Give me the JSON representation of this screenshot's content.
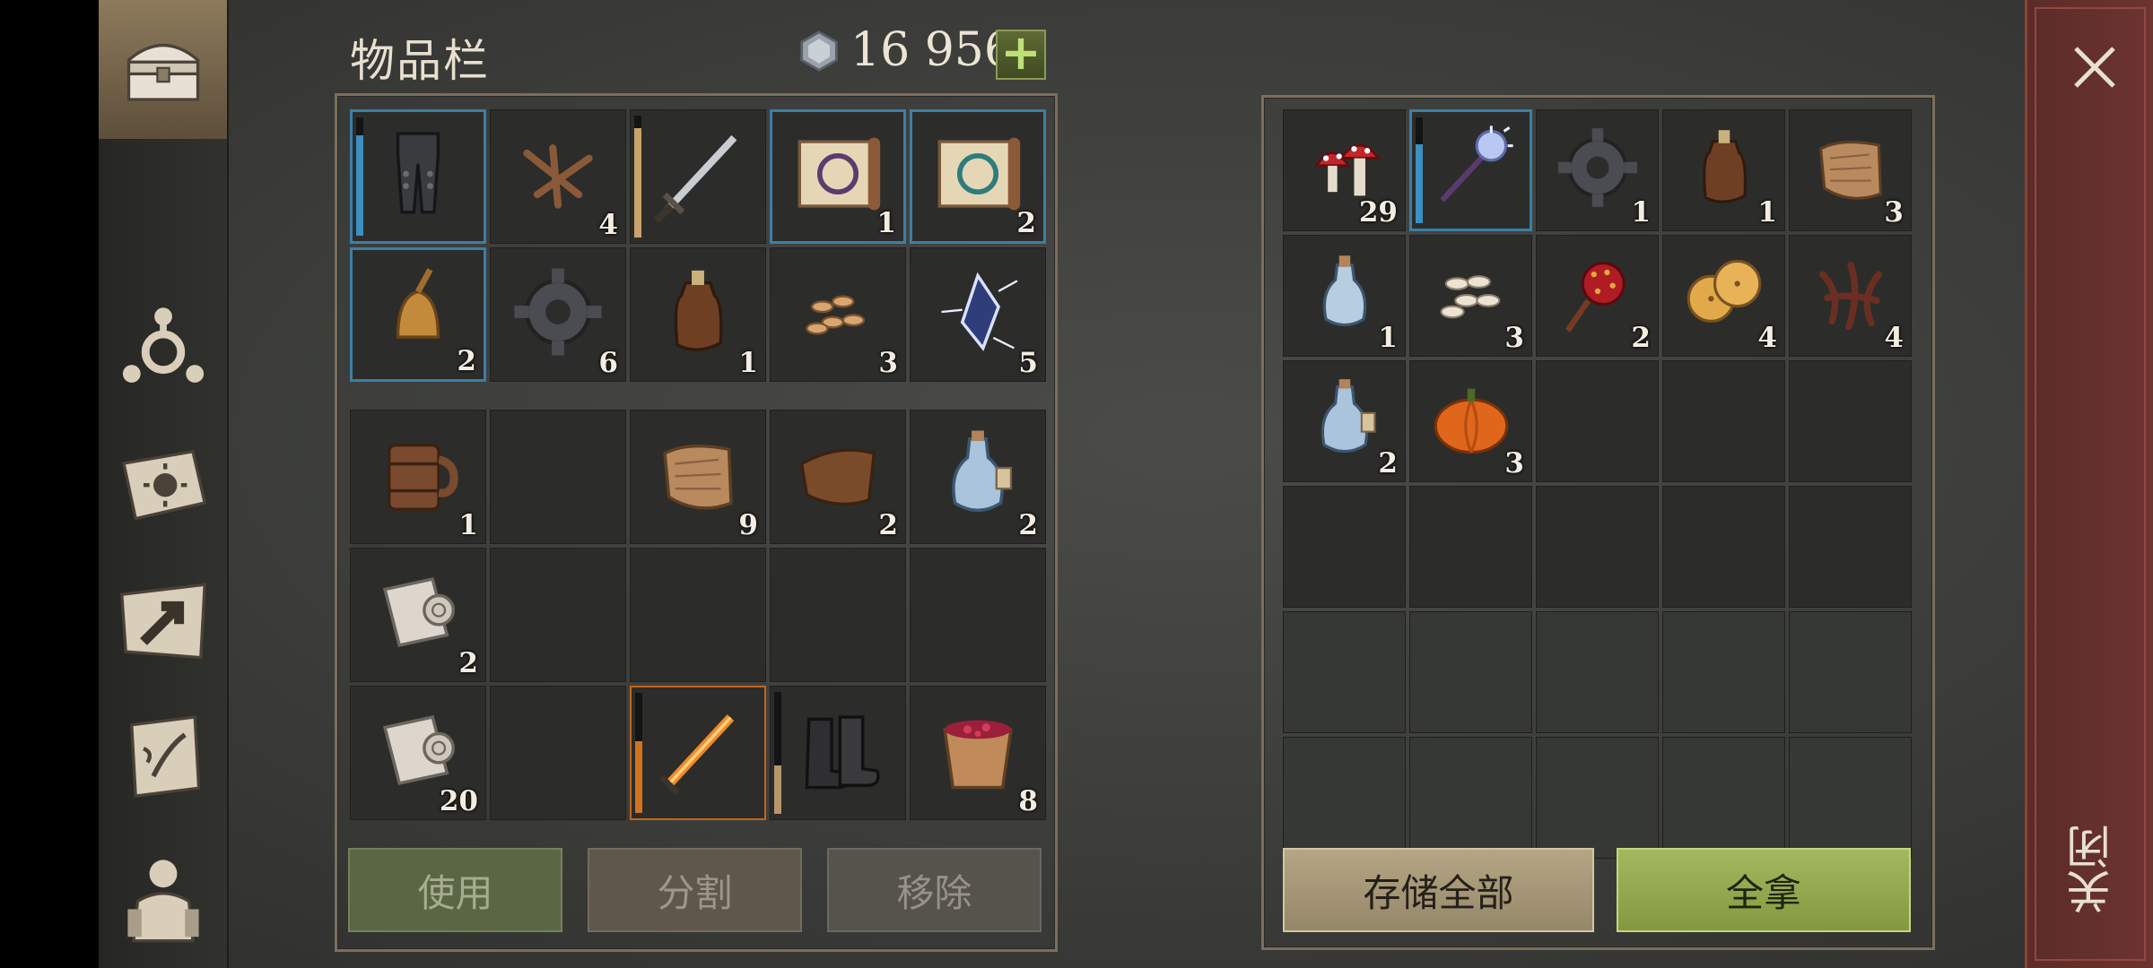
{
  "header": {
    "title": "物品栏",
    "currency_value": "16 956",
    "add_label": "+"
  },
  "colors": {
    "accent_green": "#a4b85f",
    "close_red": "#6d3430",
    "selection_blue": "#3b7fa6",
    "rarity_orange": "#c3651b"
  },
  "sidebar": {
    "items": [
      {
        "icon": "chest-icon",
        "active": true
      },
      {
        "icon": "crafting-icon"
      },
      {
        "icon": "sun-book-icon"
      },
      {
        "icon": "map-arrow-icon"
      },
      {
        "icon": "quest-scroll-icon"
      },
      {
        "icon": "character-icon"
      }
    ]
  },
  "inventory": {
    "equipped_slots": [
      {
        "name": "leg-armor",
        "qty": "",
        "selected": true,
        "durability": 0.85,
        "dur_color": "#3b8fc1"
      },
      {
        "name": "nails",
        "qty": "4"
      },
      {
        "name": "sword",
        "qty": "",
        "durability": 0.9,
        "dur_color": "#c9a46a"
      },
      {
        "name": "recipe-scroll-purple",
        "qty": "1",
        "selected": true
      },
      {
        "name": "recipe-scroll-teal",
        "qty": "2",
        "selected": true
      },
      {
        "name": "bronze-bell",
        "qty": "2",
        "selected": true
      },
      {
        "name": "gear",
        "qty": "6"
      },
      {
        "name": "leather-flask",
        "qty": "1"
      },
      {
        "name": "seeds",
        "qty": "3"
      },
      {
        "name": "crystal",
        "qty": "5"
      }
    ],
    "backpack_slots": [
      {
        "name": "wooden-mug",
        "qty": "1"
      },
      {
        "name": "",
        "qty": ""
      },
      {
        "name": "cloth",
        "qty": "9"
      },
      {
        "name": "leather",
        "qty": "2"
      },
      {
        "name": "water-flask",
        "qty": "2"
      },
      {
        "name": "paper-roll",
        "qty": "2"
      },
      {
        "name": "",
        "qty": ""
      },
      {
        "name": "",
        "qty": ""
      },
      {
        "name": "",
        "qty": ""
      },
      {
        "name": "",
        "qty": ""
      },
      {
        "name": "paper-roll",
        "qty": "20"
      },
      {
        "name": "",
        "qty": ""
      },
      {
        "name": "flame-sword",
        "qty": "",
        "rarity": "orange",
        "durability": 0.6,
        "dur_color": "#d2741f"
      },
      {
        "name": "boots",
        "qty": "",
        "durability": 0.4,
        "dur_color": "#b7966a"
      },
      {
        "name": "berry-bucket",
        "qty": "8"
      }
    ],
    "buttons": {
      "use": "使用",
      "split": "分割",
      "remove": "移除"
    }
  },
  "storage": {
    "slots": [
      {
        "name": "mushrooms",
        "qty": "29"
      },
      {
        "name": "crystal-mace",
        "qty": "",
        "selected": true,
        "durability": 0.75,
        "dur_color": "#3b8fc1"
      },
      {
        "name": "gear",
        "qty": "1"
      },
      {
        "name": "leather-flask",
        "qty": "1"
      },
      {
        "name": "cloth",
        "qty": "3"
      },
      {
        "name": "water-flask-small",
        "qty": "1"
      },
      {
        "name": "seeds-white",
        "qty": "3"
      },
      {
        "name": "candy-apple",
        "qty": "2"
      },
      {
        "name": "cookies",
        "qty": "4"
      },
      {
        "name": "roots",
        "qty": "4"
      },
      {
        "name": "water-flask",
        "qty": "2"
      },
      {
        "name": "pumpkin",
        "qty": "3"
      },
      {
        "name": "",
        "qty": ""
      },
      {
        "name": "",
        "qty": ""
      },
      {
        "name": "",
        "qty": ""
      },
      {
        "name": "",
        "qty": ""
      },
      {
        "name": "",
        "qty": ""
      },
      {
        "name": "",
        "qty": ""
      },
      {
        "name": "",
        "qty": ""
      },
      {
        "name": "",
        "qty": ""
      },
      {
        "name": "",
        "qty": "",
        "faded": true
      },
      {
        "name": "",
        "qty": "",
        "faded": true
      },
      {
        "name": "",
        "qty": "",
        "faded": true
      },
      {
        "name": "",
        "qty": "",
        "faded": true
      },
      {
        "name": "",
        "qty": "",
        "faded": true
      },
      {
        "name": "",
        "qty": "",
        "faded": true
      },
      {
        "name": "",
        "qty": "",
        "faded": true
      },
      {
        "name": "",
        "qty": "",
        "faded": true
      },
      {
        "name": "",
        "qty": "",
        "faded": true
      },
      {
        "name": "",
        "qty": "",
        "faded": true
      }
    ],
    "buttons": {
      "store_all": "存储全部",
      "take_all": "全拿"
    }
  },
  "close": {
    "label": "关闭",
    "icon": "close-icon"
  }
}
